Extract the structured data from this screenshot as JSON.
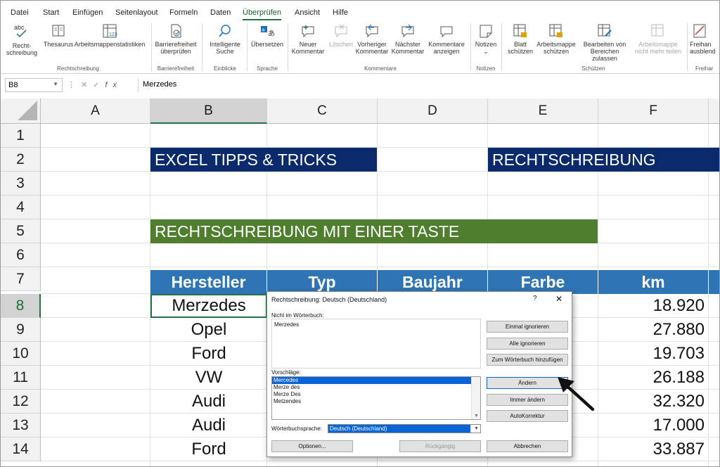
{
  "menu": {
    "tabs": [
      "Datei",
      "Start",
      "Einfügen",
      "Seitenlayout",
      "Formeln",
      "Daten",
      "Überprüfen",
      "Ansicht",
      "Hilfe"
    ],
    "active": "Überprüfen"
  },
  "ribbon": {
    "abc_icon_text": "abc",
    "rechtschreibung": "Recht-\nschreibung",
    "thesaurus": "Thesaurus",
    "arbeitsmappenstatistiken": "Arbeitsmappenstatistiken",
    "barrierefreiheit_pruefen": "Barrierefreiheit\nüberprüfen",
    "intelligente_suche": "Intelligente\nSuche",
    "uebersetzen": "Übersetzen",
    "neuer_kommentar": "Neuer\nKommentar",
    "loeschen": "Löschen",
    "vorheriger_kommentar": "Vorheriger\nKommentar",
    "naechster_kommentar": "Nächster\nKommentar",
    "kommentare_anzeigen": "Kommentare\nanzeigen",
    "notizen": "Notizen",
    "blatt_schuetzen": "Blatt\nschützen",
    "arbeitsmappe_schuetzen": "Arbeitsmappe\nschützen",
    "bearbeiten_von_bereichen": "Bearbeiten von\nBereichen zulassen",
    "arbeitsmappe_nicht_mehr_teilen": "Arbeitsmappe\nnicht mehr teilen",
    "freihand": "Freihan\nausblend",
    "groups": {
      "rechtschreibung": "Rechtschreibung",
      "barrierefreiheit": "Barrierefreiheit",
      "einblicke": "Einblicke",
      "sprache": "Sprache",
      "kommentare": "Kommentare",
      "notizen": "Notizen",
      "schuetzen": "Schützen",
      "freihand": "Freihar"
    }
  },
  "formula_bar": {
    "cell_ref": "B8",
    "fx": "fx",
    "value": "Merzedes"
  },
  "sheet": {
    "columns": [
      "A",
      "B",
      "C",
      "D",
      "E",
      "F"
    ],
    "rows": [
      "1",
      "2",
      "3",
      "4",
      "5",
      "6",
      "7",
      "8",
      "9",
      "10",
      "11",
      "12",
      "13",
      "14"
    ],
    "banner_left": "EXCEL TIPPS & TRICKS",
    "banner_right": "RECHTSCHREIBUNG",
    "green_banner": "RECHTSCHREIBUNG MIT EINER TASTE",
    "table_headers": [
      "Hersteller",
      "Typ",
      "Baujahr",
      "Farbe",
      "km"
    ],
    "hersteller": [
      "Merzedes",
      "Opel",
      "Ford",
      "VW",
      "Audi",
      "Audi",
      "Ford"
    ],
    "km": [
      "18.920",
      "27.880",
      "19.703",
      "26.188",
      "32.320",
      "17.000",
      "33.887"
    ]
  },
  "dialog": {
    "title": "Rechtschreibung: Deutsch (Deutschland)",
    "help": "?",
    "close": "✕",
    "not_in_dict_label": "Nicht im Wörterbuch:",
    "not_in_dict_value": "Merzedes",
    "suggestions_label": "Vorschläge:",
    "suggestions": [
      "Mercedes",
      "Merze des",
      "Merze Des",
      "Metzendes"
    ],
    "language_label": "Wörterbuchsprache:",
    "language_value": "Deutsch (Deutschland)",
    "buttons": {
      "einmal_ignorieren": "Einmal ignorieren",
      "alle_ignorieren": "Alle ignorieren",
      "zum_woerterbuch": "Zum Wörterbuch hinzufügen",
      "aendern": "Ändern",
      "immer_aendern": "Immer ändern",
      "autokorrektur": "AutoKorrektur",
      "optionen": "Optionen...",
      "rueckgaengig": "Rückgängig",
      "abbrechen": "Abbrechen"
    }
  },
  "colors": {
    "navy_banner": "#0a2a6b",
    "green_banner": "#4f7f2e",
    "table_header": "#2f75b5",
    "excel_green": "#217346",
    "selection_blue": "#0a64d6"
  }
}
